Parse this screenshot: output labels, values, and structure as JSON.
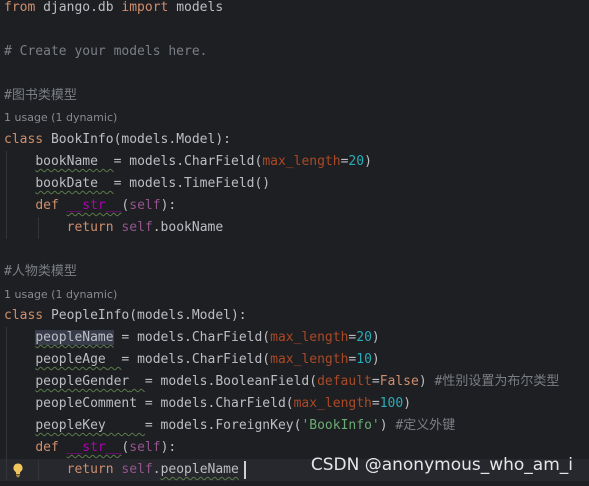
{
  "code": {
    "l_import": {
      "kw_from": "from",
      "module": " django.db ",
      "kw_import": "import",
      "name": " models"
    },
    "l_comment_models": "# Create your models here.",
    "l_comment_book": "#图书类模型",
    "hint_book": "1 usage (1 dynamic)",
    "l_class_book": {
      "kw_class": "class",
      "name": " BookInfo(models.Model):"
    },
    "l_bookname": {
      "indent": "    ",
      "field": "bookName",
      "pad": "  ",
      "rest1": "= models.CharField(",
      "param": "max_length",
      "eq": "=",
      "num": "20",
      "close": ")"
    },
    "l_bookdate": {
      "indent": "    ",
      "field": "bookDate",
      "pad": "  ",
      "rest1": "= models.TimeField()"
    },
    "l_def_book": {
      "indent": "    ",
      "kw_def": "def",
      "sp": " ",
      "magic": "__str__",
      "open": "(",
      "self": "self",
      "close": "):"
    },
    "l_return_book": {
      "indent": "        ",
      "kw_return": "return",
      "sp": " ",
      "self": "self",
      "attr": ".bookName"
    },
    "l_comment_people": "#人物类模型",
    "hint_people": "1 usage (1 dynamic)",
    "l_class_people": {
      "kw_class": "class",
      "name": " PeopleInfo(models.Model):"
    },
    "l_peoplename": {
      "indent": "    ",
      "field": "peopleName",
      "rest1": " = models.CharField(",
      "param": "max_length",
      "eq": "=",
      "num": "20",
      "close": ")"
    },
    "l_peopleage": {
      "indent": "    ",
      "field": "peopleAge",
      "pad": "  ",
      "rest1": "= models.CharField(",
      "param": "max_length",
      "eq": "=",
      "num": "10",
      "close": ")"
    },
    "l_peoplegender": {
      "indent": "    ",
      "field": "peopleGender",
      "pad": "  ",
      "rest1": "= models.BooleanField(",
      "param": "default",
      "eq": "=",
      "kw_false": "False",
      "close": ") ",
      "comment": "#性别设置为布尔类型"
    },
    "l_peoplecomment": {
      "indent": "    ",
      "field": "peopleComment",
      "rest1": " = models.CharField(",
      "param": "max_length",
      "eq": "=",
      "num": "100",
      "close": ")"
    },
    "l_peoplekey": {
      "indent": "    ",
      "field": "peopleKey",
      "pad": "     ",
      "rest1": "= models.ForeignKey(",
      "str": "'BookInfo'",
      "close": ") ",
      "comment": "#定义外键"
    },
    "l_def_people": {
      "indent": "    ",
      "kw_def": "def",
      "sp": " ",
      "magic": "__str__",
      "open": "(",
      "self": "self",
      "close": "):"
    },
    "l_return_people": {
      "indent": "        ",
      "kw_return": "return",
      "sp": " ",
      "self": "self",
      "dot": ".",
      "attr": "peopleName"
    }
  },
  "watermark": "CSDN @anonymous_who_am_i",
  "icons": {
    "intention": "lightbulb-icon"
  },
  "colors": {
    "background": "#1e1f22",
    "keyword": "#cf8e6d",
    "number": "#2aacb8",
    "string": "#6aab73",
    "named_param": "#aa4926",
    "self": "#94558d",
    "magic_method": "#b200b2",
    "comment": "#7a7e85"
  }
}
